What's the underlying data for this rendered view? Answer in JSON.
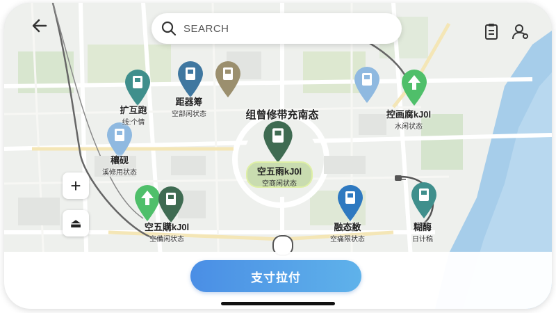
{
  "header": {
    "back_icon": "arrow-left-icon",
    "search_placeholder": "SEARCH",
    "search_icon": "search-icon",
    "list_icon": "clipboard-icon",
    "profile_icon": "user-settings-icon"
  },
  "map_controls": {
    "zoom_in_label": "+",
    "layers_label": "⏏"
  },
  "center": {
    "title": "组曾修带充南态",
    "bubble_line1": "空五雨kJ0l",
    "bubble_line2": "空商闲状态"
  },
  "stations": [
    {
      "line1": "扩互跑",
      "line2": "线:个情"
    },
    {
      "line1": "距器筹",
      "line2": "空部闲状态"
    },
    {
      "line1": "控画腐kJ0l",
      "line2": "水闲状态"
    },
    {
      "line1": "穰砚",
      "line2": "溪修用状态"
    },
    {
      "line1": "空五購kJ0l",
      "line2": "空備闲状态"
    },
    {
      "line1": "融态敝",
      "line2": "空痛限状态"
    },
    {
      "line1": "糊酶",
      "line2": "日计稿"
    }
  ],
  "colors": {
    "pin_teal": "#3f8f8c",
    "pin_steel": "#3f77a0",
    "pin_olive": "#9b8f6e",
    "pin_light_blue": "#8fb9e0",
    "pin_green": "#4fbf6a",
    "pin_dark_green": "#3f6b52",
    "pin_blue": "#2e79c0",
    "water": "#9fc9e8",
    "accent": "#4a8ee5"
  },
  "bottom": {
    "pay_button": "支寸拉付"
  }
}
